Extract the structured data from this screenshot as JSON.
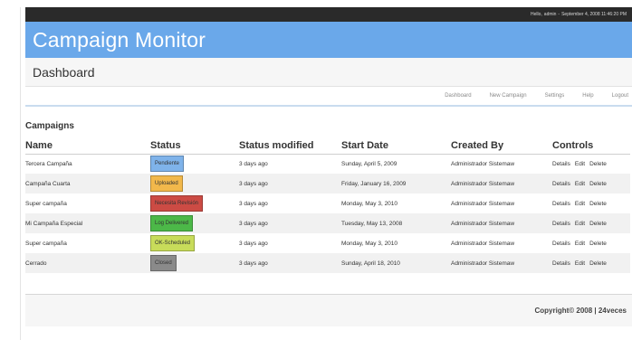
{
  "topbar": {
    "greeting": "Hello,",
    "user": "admin",
    "separator": "-",
    "datetime": "September 4, 2008 11:46:20 PM"
  },
  "header": {
    "title": "Campaign Monitor"
  },
  "page": {
    "title": "Dashboard"
  },
  "nav": {
    "items": [
      "Dashboard",
      "New Campaign",
      "Settings",
      "Help",
      "Logout"
    ]
  },
  "campaigns": {
    "title": "Campaigns",
    "columns": [
      "Name",
      "Status",
      "Status modified",
      "Start Date",
      "Created By",
      "Controls"
    ],
    "controls": [
      "Details",
      "Edit",
      "Delete"
    ],
    "rows": [
      {
        "name": "Tercera Campaña",
        "status": "Pendiente",
        "status_color": "#7fb3ea",
        "modified": "3 days ago",
        "start": "Sunday, April 5, 2009",
        "created_by": "Administrador Sistemaw"
      },
      {
        "name": "Campaña Cuarta",
        "status": "Uploaded",
        "status_color": "#f2b84b",
        "modified": "3 days ago",
        "start": "Friday, January 16, 2009",
        "created_by": "Administrador Sistemaw"
      },
      {
        "name": "Super campaña",
        "status": "Necesita Revisión",
        "status_color": "#cc4b44",
        "modified": "3 days ago",
        "start": "Monday, May 3, 2010",
        "created_by": "Administrador Sistemaw"
      },
      {
        "name": "Mi Campaña Especial",
        "status": "Log Delivered",
        "status_color": "#4cb848",
        "modified": "3 days ago",
        "start": "Tuesday, May 13, 2008",
        "created_by": "Administrador Sistemaw"
      },
      {
        "name": "Super campaña",
        "status": "OK-Scheduled",
        "status_color": "#c8dc5a",
        "modified": "3 days ago",
        "start": "Monday, May 3, 2010",
        "created_by": "Administrador Sistemaw"
      },
      {
        "name": "Cerrado",
        "status": "Closed",
        "status_color": "#8a8a8a",
        "modified": "3 days ago",
        "start": "Sunday, April 18, 2010",
        "created_by": "Administrador Sistemaw"
      }
    ]
  },
  "footer": {
    "copyright": "Copyright© 2008 | 24veces"
  }
}
